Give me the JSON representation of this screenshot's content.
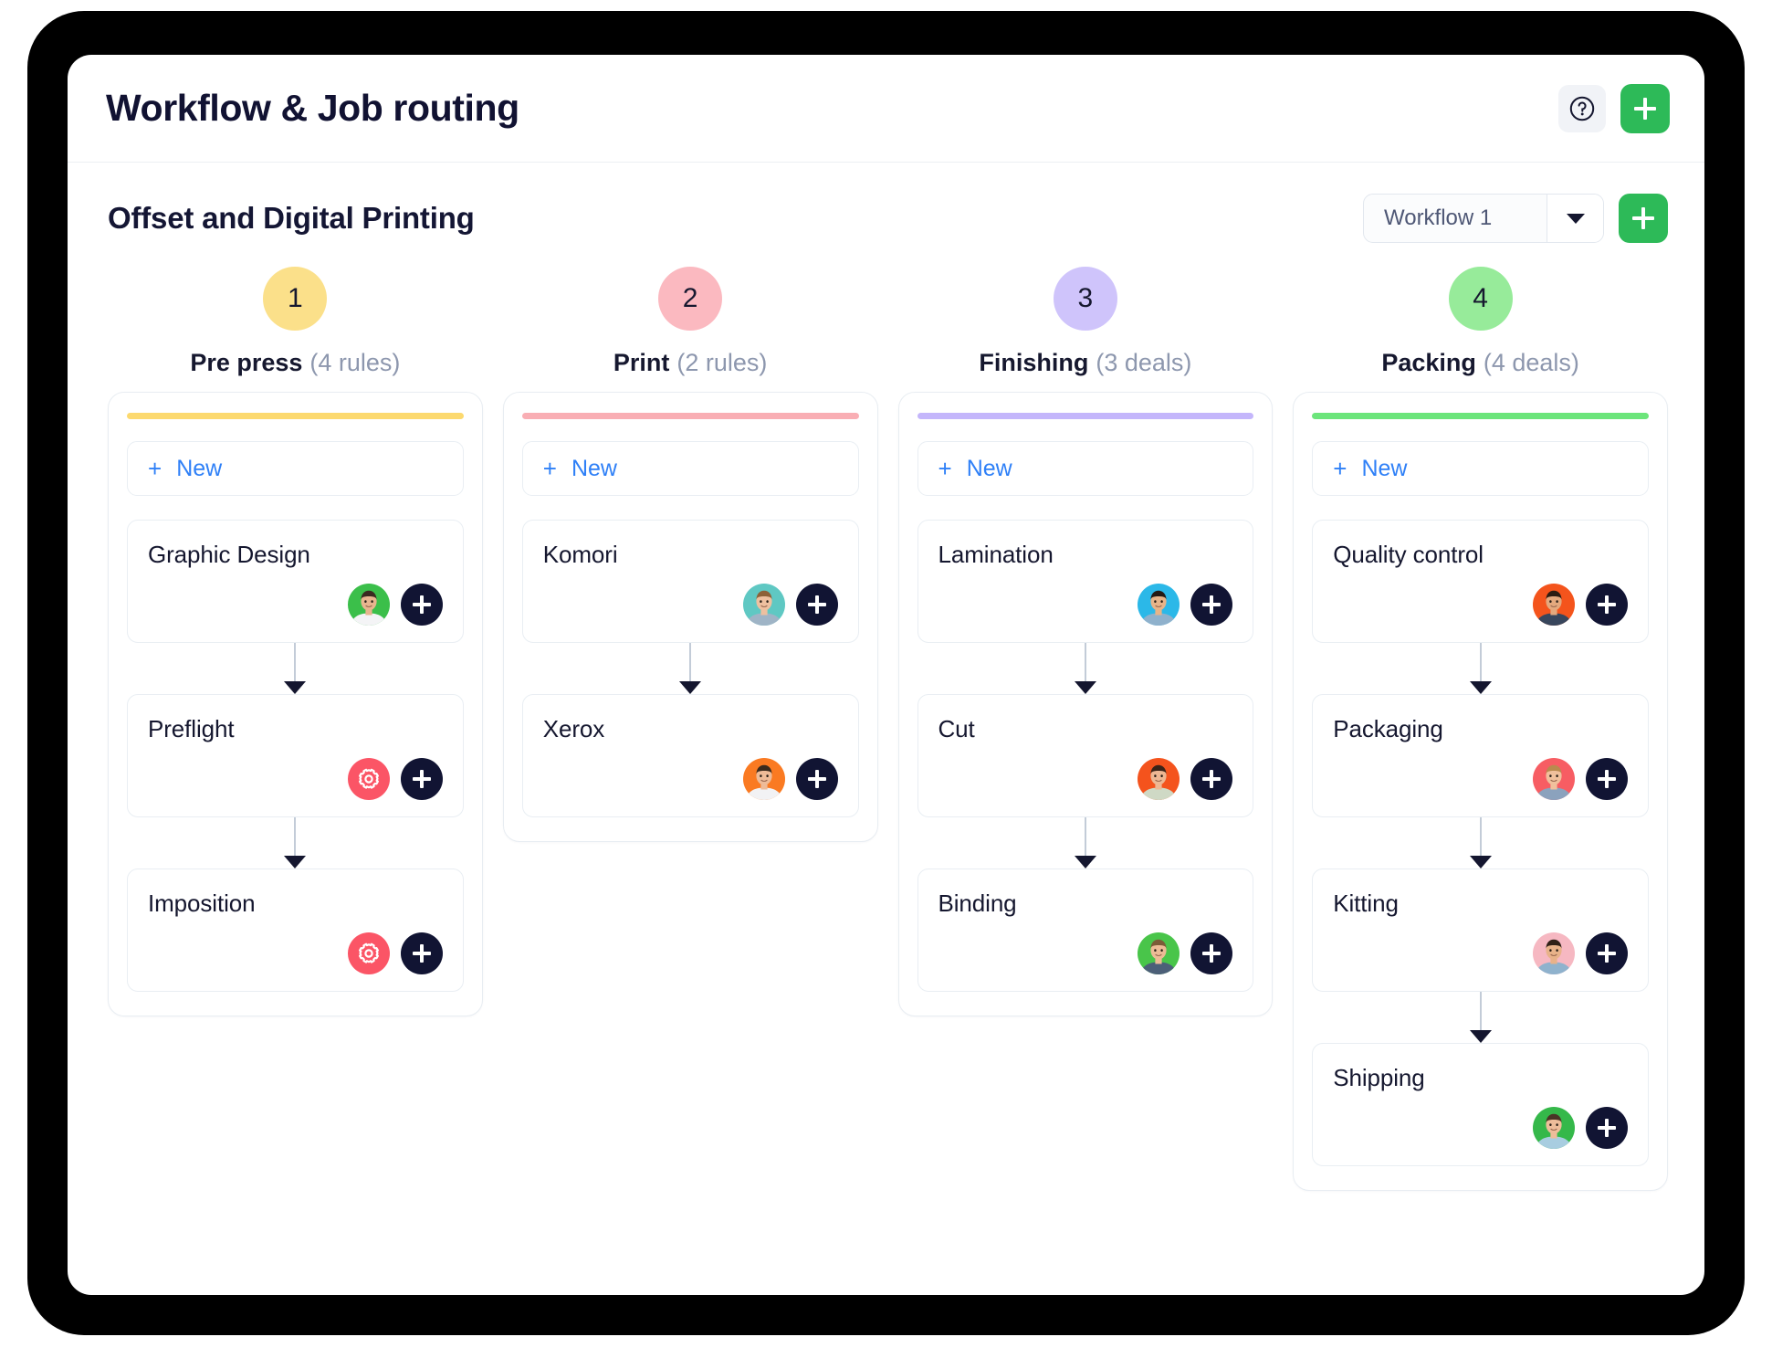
{
  "app": {
    "title": "Workflow & Job routing",
    "help_icon": "question-mark-circle-icon",
    "add_label": "+"
  },
  "section": {
    "title": "Offset and Digital Printing",
    "workflow_select": {
      "value": "Workflow 1",
      "caret_icon": "chevron-down-icon"
    },
    "add_workflow_label": "+"
  },
  "new_button_label": "New",
  "new_button_plus": "+",
  "columns": [
    {
      "number": "1",
      "name": "Pre press",
      "count": "(4 rules)",
      "circle_color": "#fbe08a",
      "accent_color": "#fcd96f",
      "nodes": [
        {
          "title": "Graphic Design",
          "badge": "avatar",
          "avatar_bg": "#3bbf4a",
          "skin": "#e8b58f",
          "hair": "#3b2a20",
          "shirt": "#f4f4f6"
        },
        {
          "title": "Preflight",
          "badge": "gear",
          "badge_color": "#fb5566",
          "badge_icon": "gear-icon"
        },
        {
          "title": "Imposition",
          "badge": "gear",
          "badge_color": "#fb5566",
          "badge_icon": "gear-icon"
        }
      ]
    },
    {
      "number": "2",
      "name": "Print",
      "count": "(2 rules)",
      "circle_color": "#fbb9c0",
      "accent_color": "#f9aeb4",
      "nodes": [
        {
          "title": "Komori",
          "badge": "avatar",
          "avatar_bg": "#5fc8c3",
          "skin": "#eec0a0",
          "hair": "#8d6138",
          "shirt": "#9fb4c6"
        },
        {
          "title": "Xerox",
          "badge": "avatar",
          "avatar_bg": "#fa7a22",
          "skin": "#eebb98",
          "hair": "#3a2a1d",
          "shirt": "#f2f2f4"
        }
      ]
    },
    {
      "number": "3",
      "name": "Finishing",
      "count": "(3 deals)",
      "circle_color": "#cfc4fb",
      "accent_color": "#c4b6fb",
      "nodes": [
        {
          "title": "Lamination",
          "badge": "avatar",
          "avatar_bg": "#2bb8e8",
          "skin": "#e7b489",
          "hair": "#241a14",
          "shirt": "#8fb1cc"
        },
        {
          "title": "Cut",
          "badge": "avatar",
          "avatar_bg": "#f4531d",
          "skin": "#edb793",
          "hair": "#3a2318",
          "shirt": "#cfd9c5"
        },
        {
          "title": "Binding",
          "badge": "avatar",
          "avatar_bg": "#49c54a",
          "skin": "#edbb96",
          "hair": "#7b5c38",
          "shirt": "#4c5f78"
        }
      ]
    },
    {
      "number": "4",
      "name": "Packing",
      "count": "(4 deals)",
      "circle_color": "#97eb9a",
      "accent_color": "#6ce57b",
      "nodes": [
        {
          "title": "Quality control",
          "badge": "avatar",
          "avatar_bg": "#f4541c",
          "skin": "#e4a97e",
          "hair": "#2b1c12",
          "shirt": "#38465c"
        },
        {
          "title": "Packaging",
          "badge": "avatar",
          "avatar_bg": "#f75d63",
          "skin": "#f0c09c",
          "hair": "#b98a4e",
          "shirt": "#8ba2bd"
        },
        {
          "title": "Kitting",
          "badge": "avatar",
          "avatar_bg": "#f6b8c2",
          "skin": "#e8b289",
          "hair": "#2f2017",
          "shirt": "#8fb2cd"
        },
        {
          "title": "Shipping",
          "badge": "avatar",
          "avatar_bg": "#35b84a",
          "skin": "#eebd9a",
          "hair": "#4a3526",
          "shirt": "#a8cde0"
        }
      ]
    }
  ]
}
